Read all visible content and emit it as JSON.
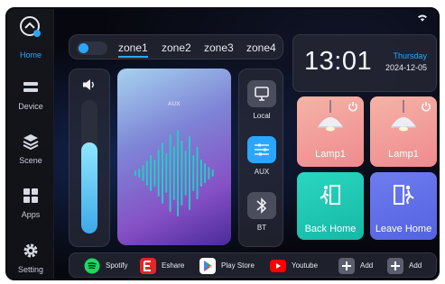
{
  "sidebar": {
    "items": [
      {
        "label": "Home",
        "icon": "home-icon",
        "active": true
      },
      {
        "label": "Device",
        "icon": "device-icon"
      },
      {
        "label": "Scene",
        "icon": "scene-layers-icon"
      },
      {
        "label": "Apps",
        "icon": "apps-grid-icon"
      },
      {
        "label": "Setting",
        "icon": "gear-icon"
      }
    ]
  },
  "zones": {
    "toggle_on": true,
    "items": [
      "zone1",
      "zone2",
      "zone3",
      "zone4"
    ],
    "active": "zone1"
  },
  "clock": {
    "time": "13:01",
    "day": "Thursday",
    "date": "2024-12-05"
  },
  "volume": {
    "level_fraction": 0.68,
    "icon": "speaker-icon"
  },
  "player": {
    "source_title": "AUX"
  },
  "sources": [
    {
      "label": "Local",
      "icon": "monitor-icon",
      "active": false
    },
    {
      "label": "AUX",
      "icon": "equalizer-icon",
      "active": true
    },
    {
      "label": "BT",
      "icon": "bluetooth-icon",
      "active": false
    }
  ],
  "lamps": [
    {
      "label": "Lamp1",
      "icon": "pendant-lamp-icon"
    },
    {
      "label": "Lamp1",
      "icon": "pendant-lamp-icon"
    }
  ],
  "scenes": [
    {
      "label": "Back Home",
      "icon": "enter-door-icon"
    },
    {
      "label": "Leave Home",
      "icon": "exit-door-icon"
    }
  ],
  "apps": [
    {
      "label": "Spotify",
      "icon": "spotify-icon"
    },
    {
      "label": "Eshare",
      "icon": "eshare-icon"
    },
    {
      "label": "Play Store",
      "icon": "play-store-icon"
    },
    {
      "label": "Youtube",
      "icon": "youtube-icon"
    },
    {
      "label": "Add",
      "icon": "plus-icon"
    },
    {
      "label": "Add",
      "icon": "plus-icon"
    }
  ],
  "colors": {
    "accent": "#2aa6ff",
    "lamp_tile": "#f08a8f",
    "back_home_tile": "#16b8a6",
    "leave_home_tile": "#5363e0"
  }
}
